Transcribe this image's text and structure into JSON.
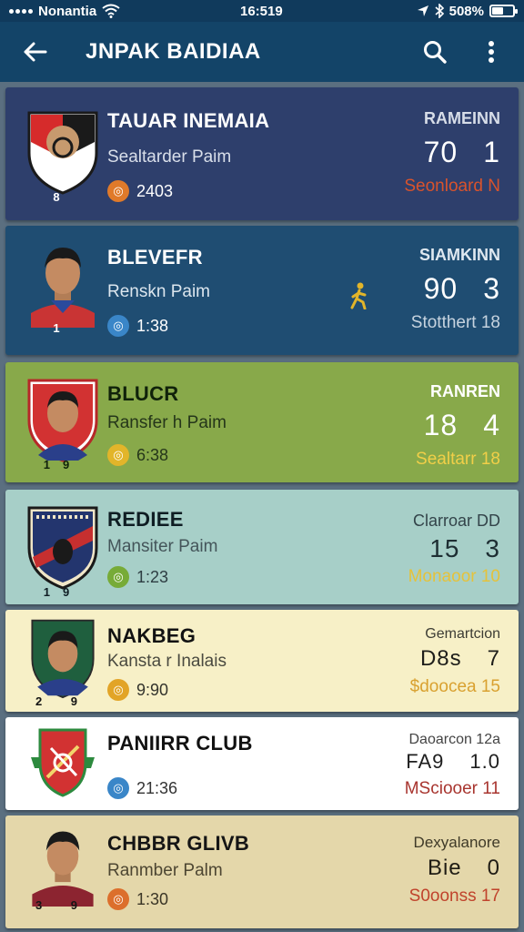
{
  "status_bar": {
    "carrier": "Nonantia",
    "time": "16:519",
    "battery": "508%"
  },
  "app_bar": {
    "title": "JNPAK BAIDIAA"
  },
  "teams": [
    {
      "name": "TAUAR INEMAIA",
      "subtitle": "Sealtarder Paim",
      "meta": "2403",
      "crest_number": "8",
      "rank_label": "RAMEINN",
      "score_left": "70",
      "score_right": "1",
      "status": "Seonloard  N",
      "colors": {
        "bg": "#2e3f6c",
        "text": "#ffffff",
        "sub": "#d9dfea",
        "rank": "#d7dde8",
        "status": "#d9532c",
        "meta_dot": "#e07a2a"
      }
    },
    {
      "name": "BLEVEFR",
      "subtitle": "Renskn Paim",
      "meta": "1:38",
      "crest_number": "1",
      "rank_label": "SIAMKINN",
      "score_left": "90",
      "score_right": "3",
      "status": "Stotthert  18",
      "colors": {
        "bg": "#1f4d72",
        "text": "#ffffff",
        "sub": "#dce6ee",
        "rank": "#dfe8f0",
        "status": "#c6d3df",
        "meta_dot": "#3a86c8"
      }
    },
    {
      "name": "BLUCR",
      "subtitle": "Ransfer h Paim",
      "meta": "6:38",
      "crest_number": "19",
      "rank_label": "RANREN",
      "score_left": "18",
      "score_right": "4",
      "status": "Sealtarr  18",
      "colors": {
        "bg": "#88a94a",
        "text": "#10220a",
        "sub": "#25361a",
        "rank": "#ffffff",
        "status": "#f1cf48",
        "meta_dot": "#e2b52a"
      }
    },
    {
      "name": "REDIEE",
      "subtitle": "Mansiter Paim",
      "meta": "1:23",
      "crest_number": "19",
      "rank_label": "Clarroar  DD",
      "score_left": "15",
      "score_right": "3",
      "status": "Monaoor  10",
      "colors": {
        "bg": "#a7cfc8",
        "text": "#0f1d23",
        "sub": "#44555a",
        "rank": "#33444a",
        "status": "#e5c23a",
        "meta_dot": "#77ab38"
      }
    },
    {
      "name": "NAKBEG",
      "subtitle": "Kansta r Inalais",
      "meta": "9:90",
      "crest_number": "2 9",
      "rank_label": "Gemartcion",
      "score_left": "D8s",
      "score_right": "7",
      "status": "$doocea  15",
      "colors": {
        "bg": "#f7f0c7",
        "text": "#121212",
        "sub": "#4a4a40",
        "rank": "#3c3c34",
        "status": "#d9a130",
        "meta_dot": "#e2a427"
      }
    },
    {
      "name": "PANIIRR CLUB",
      "subtitle": "",
      "meta": "21:36",
      "crest_number": "",
      "rank_label": "Daoarcon  12a",
      "score_left": "FA9",
      "score_right": "1.0",
      "status": "MSciooer  11",
      "colors": {
        "bg": "#ffffff",
        "text": "#111111",
        "sub": "#4a4a4a",
        "rank": "#444444",
        "status": "#a8352f",
        "meta_dot": "#3a86c8"
      }
    },
    {
      "name": "CHBBR GLIVB",
      "subtitle": "Ranmber Palm",
      "meta": "1:30",
      "crest_number": "3 9",
      "rank_label": "Dexyalanore",
      "score_left": "Bie",
      "score_right": "0",
      "status": "S0oonss  17",
      "colors": {
        "bg": "#e4d7aa",
        "text": "#151515",
        "sub": "#4d4632",
        "rank": "#3f3a28",
        "status": "#c0432c",
        "meta_dot": "#dc6f2c"
      }
    }
  ],
  "icons": {
    "signal": "signal-dots-icon",
    "wifi": "wifi-icon",
    "location": "location-arrow-icon",
    "bluetooth": "bluetooth-icon",
    "battery": "battery-icon",
    "back": "arrow-left-icon",
    "search": "search-icon",
    "more": "more-vertical-icon",
    "runner": "runner-icon"
  },
  "colors": {
    "status_bar_bg": "#103a5c",
    "app_bar_bg": "#134468",
    "page_bg": "#5b6f80"
  }
}
